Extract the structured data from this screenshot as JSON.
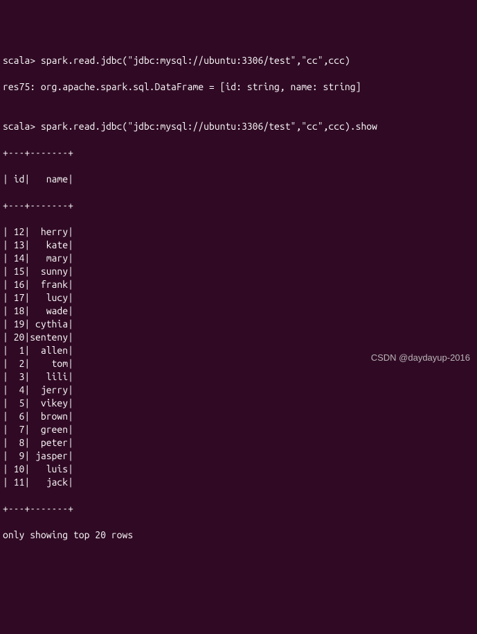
{
  "line1_prompt": "scala> ",
  "line1_cmd": "spark.read.jdbc(\"jdbc:mysql://ubuntu:3306/test\",\"cc\",ccc)",
  "line2": "res75: org.apache.spark.sql.DataFrame = [id: string, name: string]",
  "blank": "",
  "line3_prompt": "scala> ",
  "line3_cmd": "spark.read.jdbc(\"jdbc:mysql://ubuntu:3306/test\",\"cc\",ccc).show",
  "sep": "+---+-------+",
  "header": "| id|   name|",
  "chart_data": {
    "type": "table",
    "columns": [
      "id",
      "name"
    ],
    "rows": [
      {
        "id": "12",
        "name": "herry"
      },
      {
        "id": "13",
        "name": "kate"
      },
      {
        "id": "14",
        "name": "mary"
      },
      {
        "id": "15",
        "name": "sunny"
      },
      {
        "id": "16",
        "name": "frank"
      },
      {
        "id": "17",
        "name": "lucy"
      },
      {
        "id": "18",
        "name": "wade"
      },
      {
        "id": "19",
        "name": "cythia"
      },
      {
        "id": "20",
        "name": "senteny"
      },
      {
        "id": "1",
        "name": "allen"
      },
      {
        "id": "2",
        "name": "tom"
      },
      {
        "id": "3",
        "name": "lili"
      },
      {
        "id": "4",
        "name": "jerry"
      },
      {
        "id": "5",
        "name": "vikey"
      },
      {
        "id": "6",
        "name": "brown"
      },
      {
        "id": "7",
        "name": "green"
      },
      {
        "id": "8",
        "name": "peter"
      },
      {
        "id": "9",
        "name": "jasper"
      },
      {
        "id": "10",
        "name": "luis"
      },
      {
        "id": "11",
        "name": "jack"
      }
    ]
  },
  "footer": "only showing top 20 rows",
  "watermark": "CSDN @daydayup-2016"
}
